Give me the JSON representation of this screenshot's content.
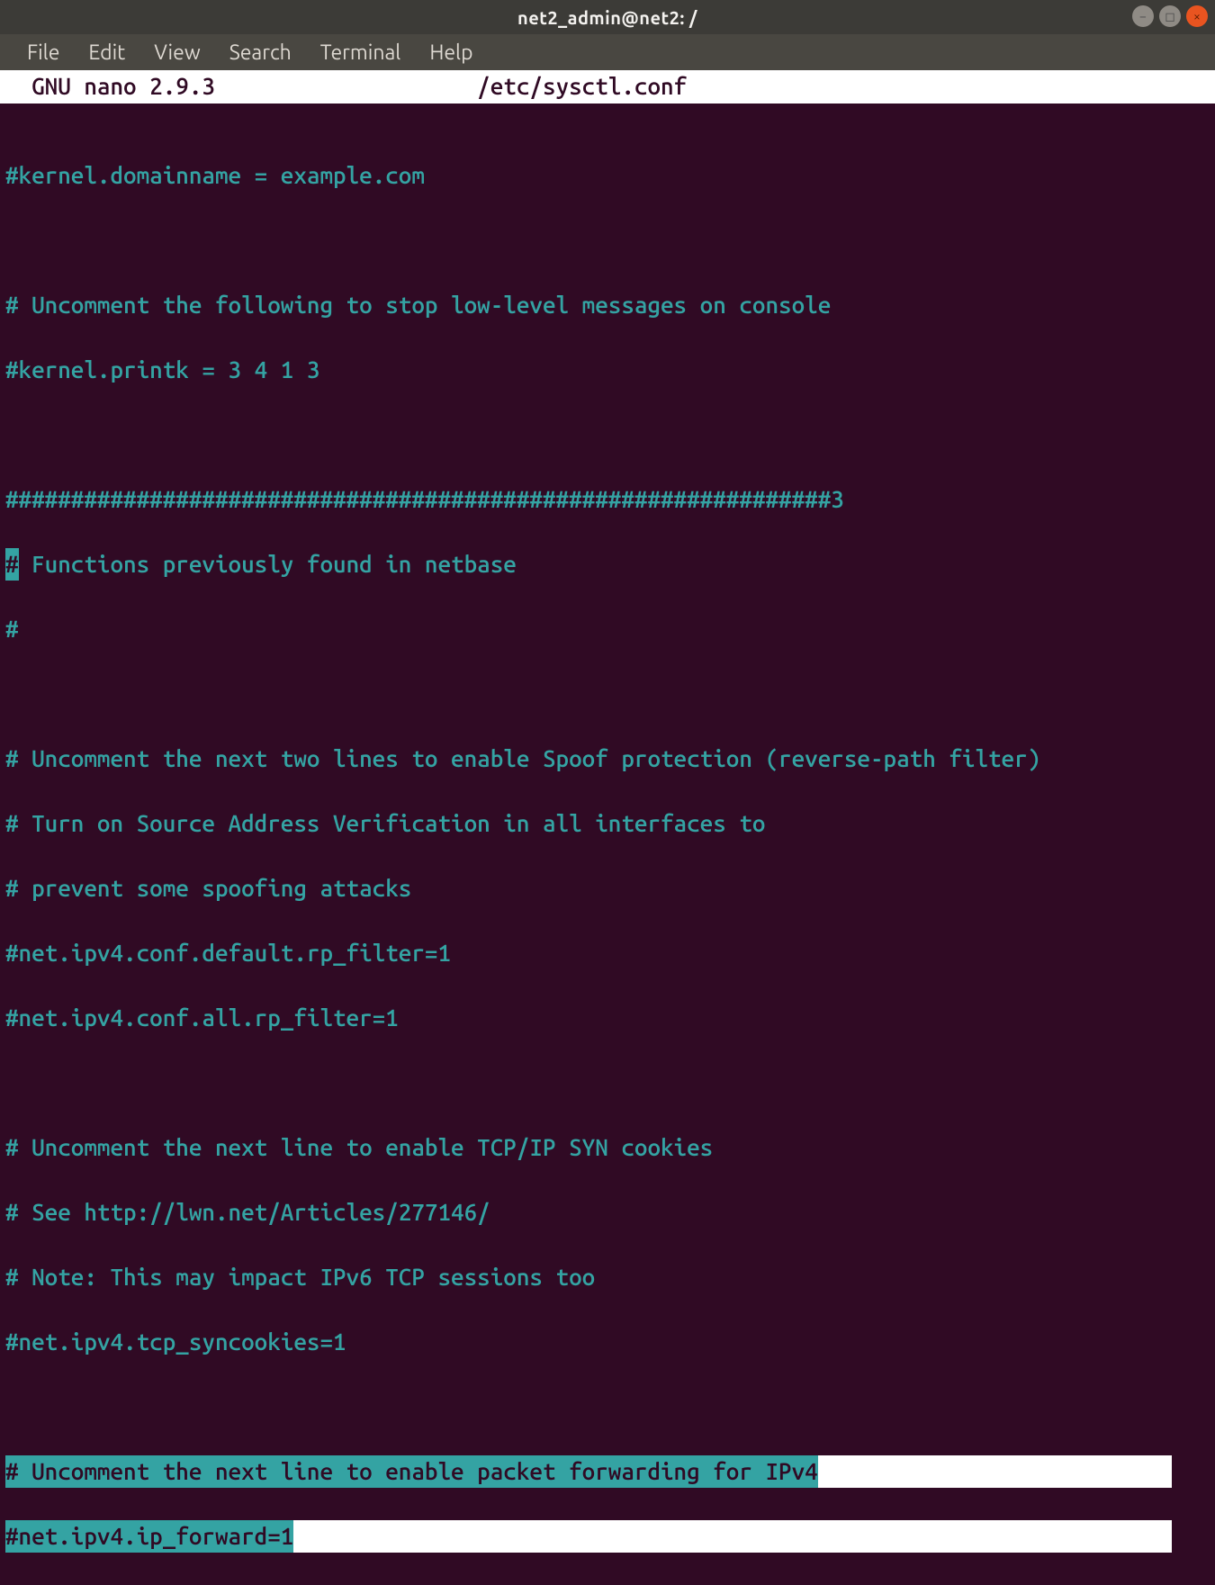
{
  "titlebar": {
    "text": "net2_admin@net2: /"
  },
  "window_controls": {
    "min": "−",
    "max": "◻",
    "close": "×"
  },
  "menubar": [
    "File",
    "Edit",
    "View",
    "Search",
    "Terminal",
    "Help"
  ],
  "nano_header": {
    "left": "  GNU nano 2.9.3",
    "file": "/etc/sysctl.conf"
  },
  "lines": {
    "l1": "#kernel.domainname = example.com",
    "l2": "# Uncomment the following to stop low-level messages on console",
    "l3": "#kernel.printk = 3 4 1 3",
    "l4": "###############################################################3",
    "l5a": "#",
    "l5b": " Functions previously found in netbase",
    "l6": "#",
    "l7": "# Uncomment the next two lines to enable Spoof protection (reverse-path filter)",
    "l8": "# Turn on Source Address Verification in all interfaces to",
    "l9": "# prevent some spoofing attacks",
    "l10": "#net.ipv4.conf.default.rp_filter=1",
    "l11": "#net.ipv4.conf.all.rp_filter=1",
    "l12": "# Uncomment the next line to enable TCP/IP SYN cookies",
    "l13": "# See http://lwn.net/Articles/277146/",
    "l14": "# Note: This may impact IPv6 TCP sessions too",
    "l15": "#net.ipv4.tcp_syncookies=1",
    "l16a": "# Uncomment the next line to enable packet forwarding for IPv4",
    "l17a": "#net.ipv4.ip_forward=1"
  }
}
